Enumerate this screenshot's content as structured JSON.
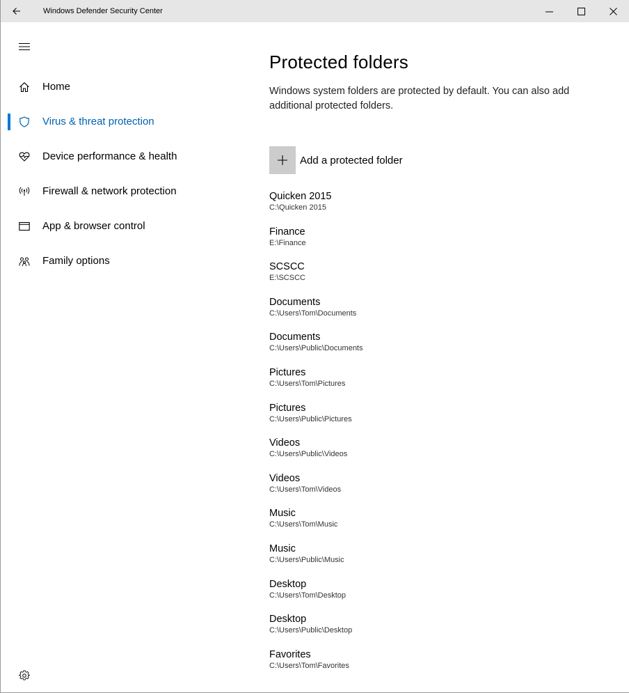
{
  "titlebar": {
    "title": "Windows Defender Security Center",
    "back_icon": "back-arrow-icon",
    "minimize_icon": "minimize-icon",
    "maximize_icon": "maximize-icon",
    "close_icon": "close-icon"
  },
  "sidebar": {
    "items": [
      {
        "label": "Home",
        "icon": "home-icon"
      },
      {
        "label": "Virus & threat protection",
        "icon": "shield-icon",
        "active": true
      },
      {
        "label": "Device performance & health",
        "icon": "heart-pulse-icon"
      },
      {
        "label": "Firewall & network protection",
        "icon": "antenna-icon"
      },
      {
        "label": "App & browser control",
        "icon": "browser-window-icon"
      },
      {
        "label": "Family options",
        "icon": "family-icon"
      }
    ]
  },
  "main": {
    "title": "Protected folders",
    "description": "Windows system folders are protected by default. You can also add additional protected folders.",
    "add_label": "Add a protected folder",
    "folders": [
      {
        "name": "Quicken 2015",
        "path": "C:\\Quicken 2015"
      },
      {
        "name": "Finance",
        "path": "E:\\Finance"
      },
      {
        "name": "SCSCC",
        "path": "E:\\SCSCC"
      },
      {
        "name": "Documents",
        "path": "C:\\Users\\Tom\\Documents"
      },
      {
        "name": "Documents",
        "path": "C:\\Users\\Public\\Documents"
      },
      {
        "name": "Pictures",
        "path": "C:\\Users\\Tom\\Pictures"
      },
      {
        "name": "Pictures",
        "path": "C:\\Users\\Public\\Pictures"
      },
      {
        "name": "Videos",
        "path": "C:\\Users\\Public\\Videos"
      },
      {
        "name": "Videos",
        "path": "C:\\Users\\Tom\\Videos"
      },
      {
        "name": "Music",
        "path": "C:\\Users\\Tom\\Music"
      },
      {
        "name": "Music",
        "path": "C:\\Users\\Public\\Music"
      },
      {
        "name": "Desktop",
        "path": "C:\\Users\\Tom\\Desktop"
      },
      {
        "name": "Desktop",
        "path": "C:\\Users\\Public\\Desktop"
      },
      {
        "name": "Favorites",
        "path": "C:\\Users\\Tom\\Favorites"
      }
    ]
  },
  "colors": {
    "accent": "#0078d7",
    "active_text": "#0063b1",
    "titlebar_bg": "#e6e6e6",
    "add_button_bg": "#cccccc"
  }
}
